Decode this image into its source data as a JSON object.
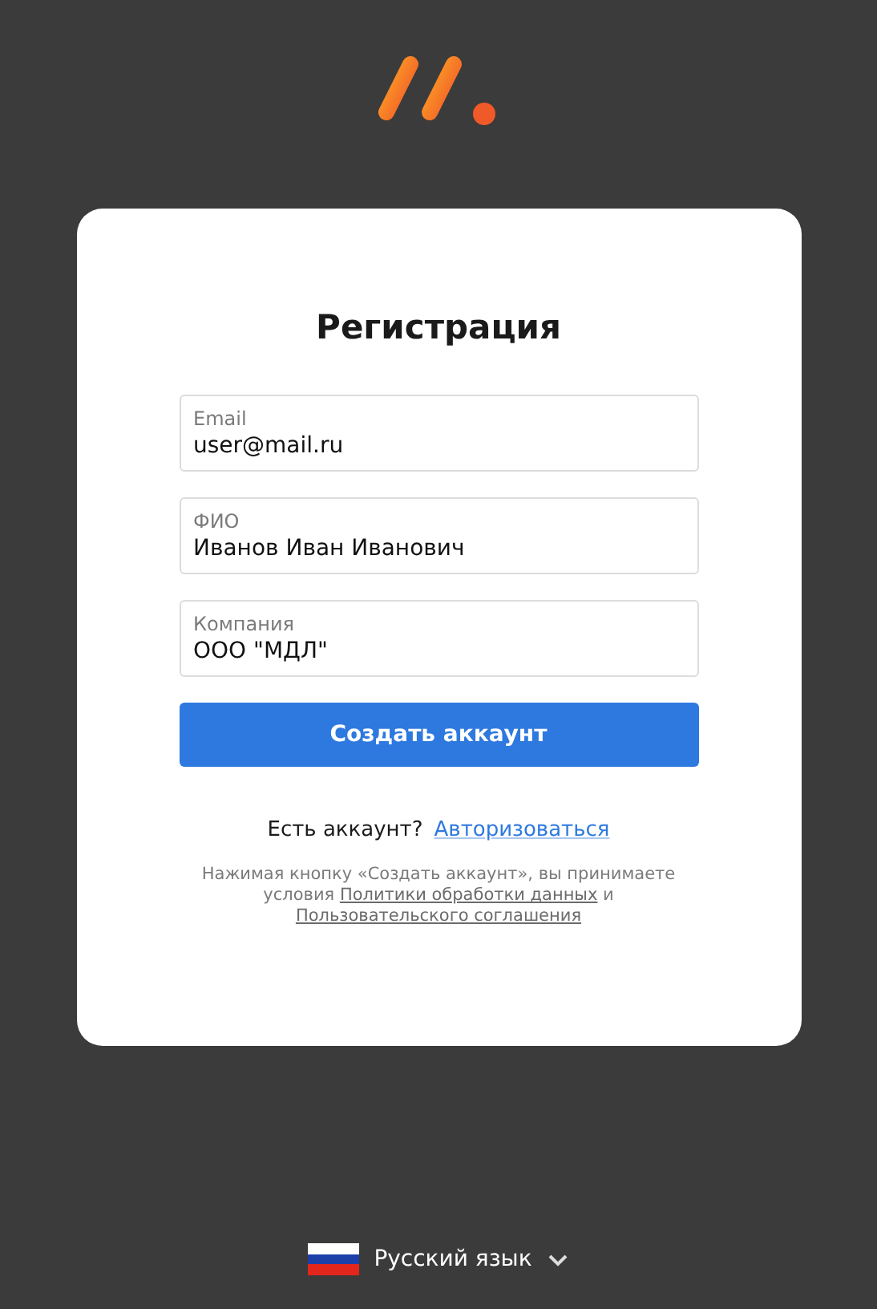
{
  "title": "Регистрация",
  "fields": [
    {
      "label": "Email",
      "value": "user@mail.ru"
    },
    {
      "label": "ФИО",
      "value": "Иванов Иван Иванович"
    },
    {
      "label": "Компания",
      "value": "ООО \"МДЛ\""
    }
  ],
  "submit": "Создать аккаунт",
  "login_prompt": {
    "text": "Есть аккаунт?",
    "link": "Авторизоваться"
  },
  "terms": [
    {
      "kind": "text",
      "text": "Нажимая кнопку «Создать аккаунт», вы принимаете условия"
    },
    {
      "kind": "link",
      "text": "Политики обработки данных"
    },
    {
      "kind": "text",
      "text": "и"
    },
    {
      "kind": "link",
      "text": "Пользовательского соглашения"
    }
  ],
  "language": {
    "label": "Русский язык"
  }
}
